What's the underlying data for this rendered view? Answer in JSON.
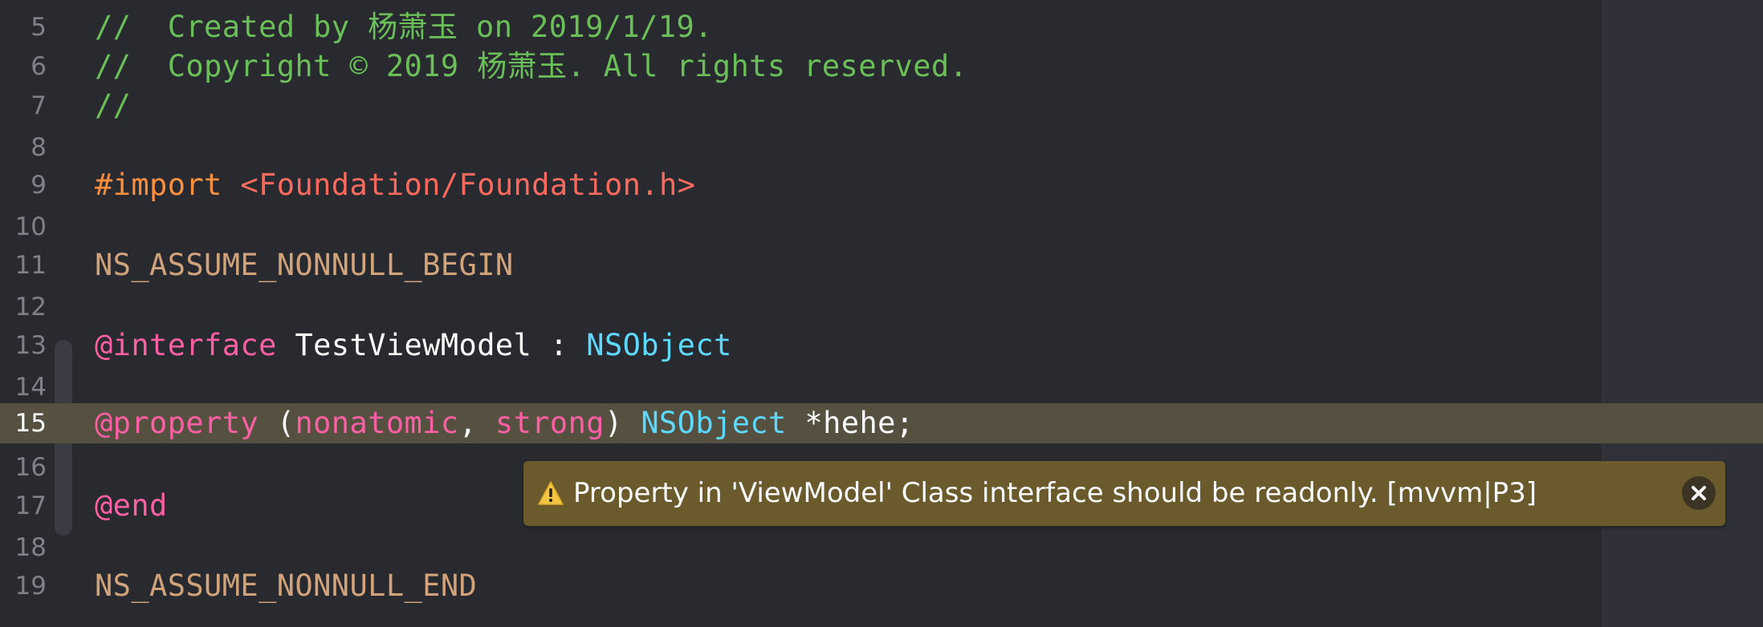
{
  "editor": {
    "current_line": "15",
    "lines": [
      {
        "num": "5",
        "tokens": [
          {
            "t": "//  Created by 杨萧玉 on 2019/1/19.",
            "k": "comment"
          }
        ]
      },
      {
        "num": "6",
        "tokens": [
          {
            "t": "//  Copyright © 2019 杨萧玉. All rights reserved.",
            "k": "comment"
          }
        ]
      },
      {
        "num": "7",
        "tokens": [
          {
            "t": "//",
            "k": "comment"
          }
        ]
      },
      {
        "num": "8",
        "tokens": []
      },
      {
        "num": "9",
        "tokens": [
          {
            "t": "#import ",
            "k": "preproc"
          },
          {
            "t": "<Foundation/Foundation.h>",
            "k": "string"
          }
        ]
      },
      {
        "num": "10",
        "tokens": []
      },
      {
        "num": "11",
        "tokens": [
          {
            "t": "NS_ASSUME_NONNULL_BEGIN",
            "k": "preproc2"
          }
        ]
      },
      {
        "num": "12",
        "tokens": []
      },
      {
        "num": "13",
        "tokens": [
          {
            "t": "@interface",
            "k": "keyword"
          },
          {
            "t": " TestViewModel : ",
            "k": "plain"
          },
          {
            "t": "NSObject",
            "k": "type"
          }
        ]
      },
      {
        "num": "14",
        "tokens": []
      },
      {
        "num": "15",
        "tokens": [
          {
            "t": "@property",
            "k": "keyword"
          },
          {
            "t": " (",
            "k": "plain"
          },
          {
            "t": "nonatomic",
            "k": "keyword"
          },
          {
            "t": ", ",
            "k": "plain"
          },
          {
            "t": "strong",
            "k": "keyword"
          },
          {
            "t": ") ",
            "k": "plain"
          },
          {
            "t": "NSObject",
            "k": "type"
          },
          {
            "t": " *hehe;",
            "k": "plain"
          }
        ]
      },
      {
        "num": "16",
        "tokens": []
      },
      {
        "num": "17",
        "tokens": [
          {
            "t": "@end",
            "k": "keyword"
          }
        ]
      },
      {
        "num": "18",
        "tokens": []
      },
      {
        "num": "19",
        "tokens": [
          {
            "t": "NS_ASSUME_NONNULL_END",
            "k": "preproc2"
          }
        ]
      }
    ]
  },
  "issue": {
    "icon": "warning-triangle-icon",
    "message": "Property in 'ViewModel' Class interface should be readonly. [mvvm|P3]",
    "close_icon": "close-icon"
  },
  "colors": {
    "background": "#292a30",
    "current_line_bg": "#555040",
    "comment": "#6bbf59",
    "keyword": "#fc5fa3",
    "type": "#5dd8ff",
    "string": "#fc6a5d",
    "preproc": "#fd8f3f",
    "warning_banner": "#6b5a2c"
  }
}
